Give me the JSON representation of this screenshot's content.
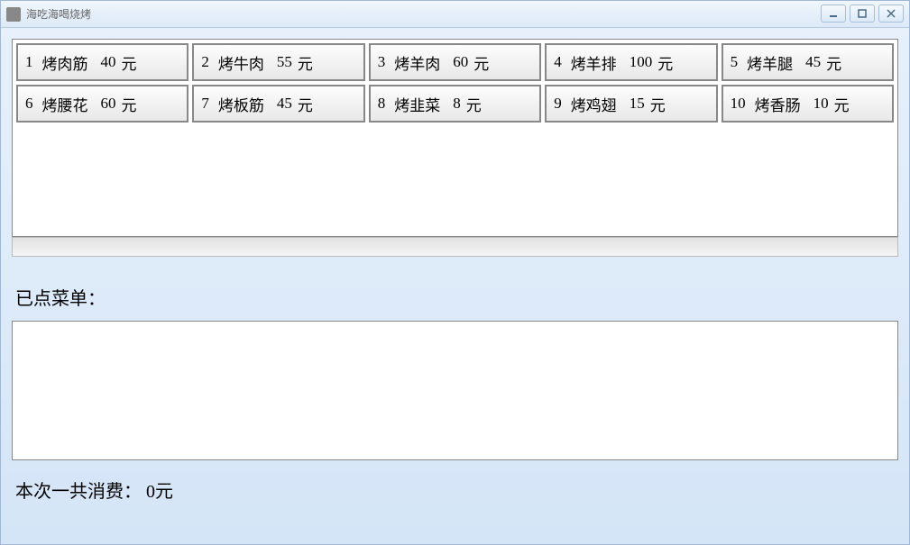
{
  "window": {
    "title": "海吃海喝烧烤"
  },
  "menu": {
    "items": [
      {
        "index": "1",
        "name": "烤肉筋",
        "price": "40",
        "unit": "元"
      },
      {
        "index": "2",
        "name": "烤牛肉",
        "price": "55",
        "unit": "元"
      },
      {
        "index": "3",
        "name": "烤羊肉",
        "price": "60",
        "unit": "元"
      },
      {
        "index": "4",
        "name": "烤羊排",
        "price": "100",
        "unit": "元"
      },
      {
        "index": "5",
        "name": "烤羊腿",
        "price": "45",
        "unit": "元"
      },
      {
        "index": "6",
        "name": "烤腰花",
        "price": "60",
        "unit": "元"
      },
      {
        "index": "7",
        "name": "烤板筋",
        "price": "45",
        "unit": "元"
      },
      {
        "index": "8",
        "name": "烤韭菜",
        "price": "8",
        "unit": "元"
      },
      {
        "index": "9",
        "name": "烤鸡翅",
        "price": "15",
        "unit": "元"
      },
      {
        "index": "10",
        "name": "烤香肠",
        "price": "10",
        "unit": "元"
      }
    ]
  },
  "ordered": {
    "label": "已点菜单："
  },
  "total": {
    "prefix": "本次一共消费：",
    "amount": "0",
    "unit": "元"
  }
}
